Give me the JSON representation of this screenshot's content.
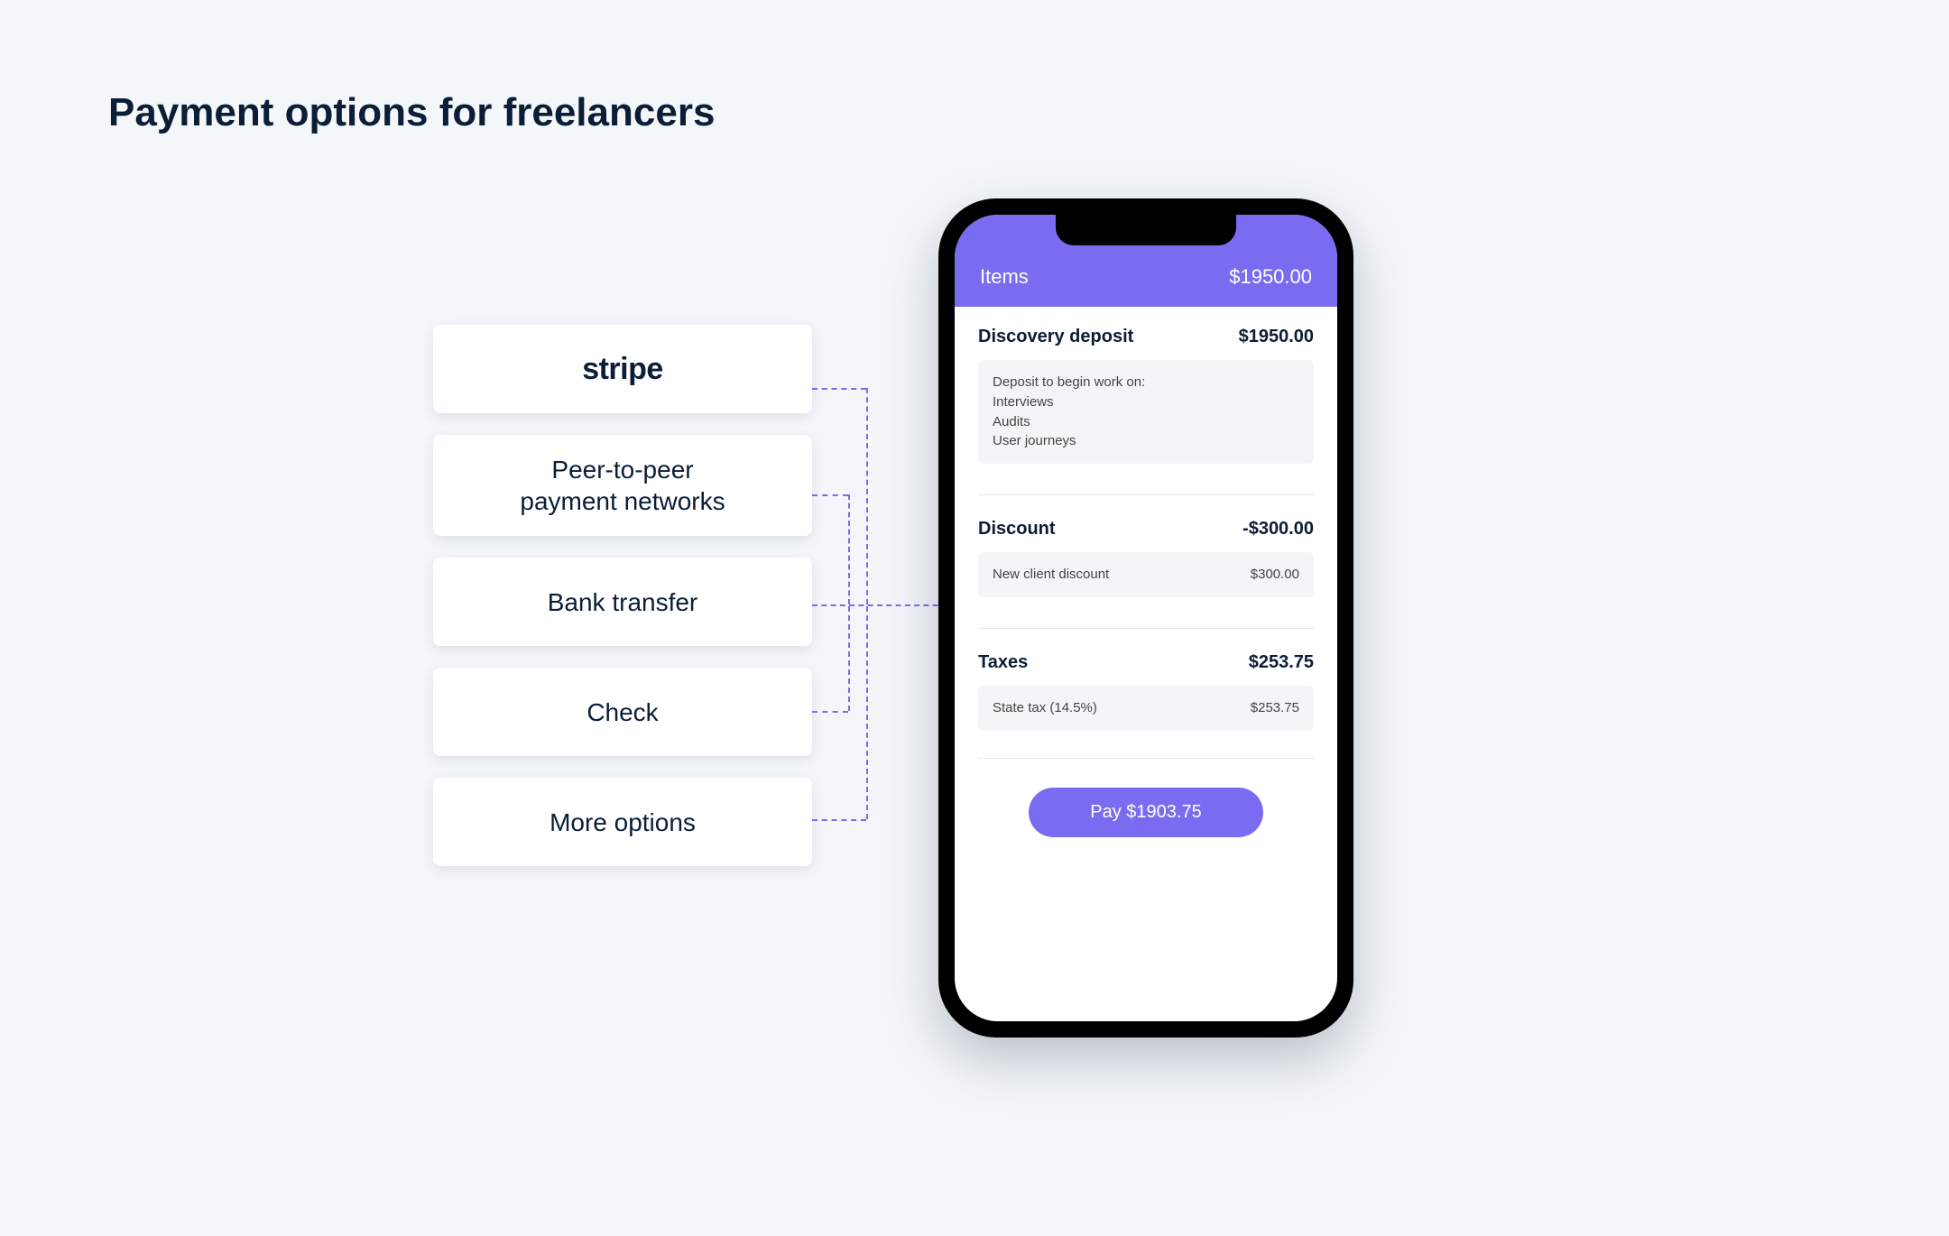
{
  "title": "Payment options for freelancers",
  "options": {
    "stripe_label": "stripe",
    "p2p_line1": "Peer-to-peer",
    "p2p_line2": "payment networks",
    "bank_label": "Bank transfer",
    "check_label": "Check",
    "more_label": "More options"
  },
  "phone": {
    "header_label": "Items",
    "header_total": "$1950.00",
    "deposit": {
      "title": "Discovery deposit",
      "amount": "$1950.00",
      "note_intro": "Deposit to begin work on:",
      "note_line1": "Interviews",
      "note_line2": "Audits",
      "note_line3": "User journeys"
    },
    "discount": {
      "title": "Discount",
      "amount": "-$300.00",
      "detail_label": "New client discount",
      "detail_amount": "$300.00"
    },
    "taxes": {
      "title": "Taxes",
      "amount": "$253.75",
      "detail_label": "State tax (14.5%)",
      "detail_amount": "$253.75"
    },
    "pay_label": "Pay $1903.75"
  },
  "colors": {
    "accent": "#7a6cf0",
    "page_bg": "#f4f7fa",
    "text_primary": "#0b1d37"
  }
}
